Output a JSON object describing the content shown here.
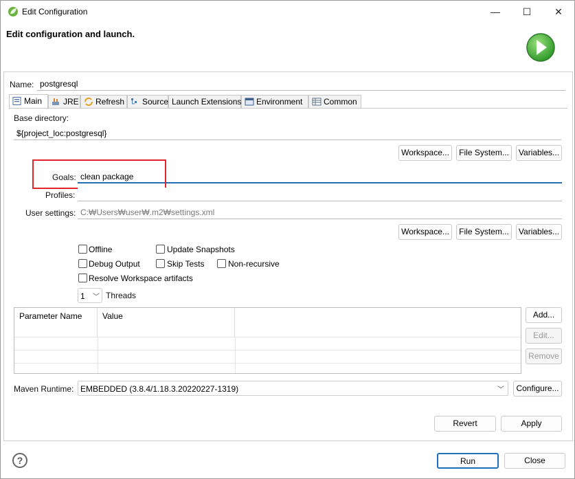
{
  "window": {
    "title": "Edit Configuration",
    "minimize": "—",
    "maximize": "☐",
    "close": "✕"
  },
  "header": {
    "title": "Edit configuration and launch."
  },
  "name": {
    "label": "Name:",
    "value": "postgresql"
  },
  "tabs": [
    {
      "label": "Main",
      "icon": "main-tab-icon"
    },
    {
      "label": "JRE",
      "icon": "jre-icon"
    },
    {
      "label": "Refresh",
      "icon": "refresh-icon"
    },
    {
      "label": "Source",
      "icon": "source-icon"
    },
    {
      "label": "Launch Extensions",
      "icon": ""
    },
    {
      "label": "Environment",
      "icon": "environment-icon"
    },
    {
      "label": "Common",
      "icon": "common-icon"
    }
  ],
  "main": {
    "base_dir_label": "Base directory:",
    "base_dir_value": "${project_loc:postgresql}",
    "workspace_btn": "Workspace...",
    "filesystem_btn": "File System...",
    "variables_btn": "Variables...",
    "goals_label": "Goals:",
    "goals_value": "clean package",
    "profiles_label": "Profiles:",
    "profiles_value": "",
    "user_settings_label": "User settings:",
    "user_settings_placeholder": "C:₩Users₩user₩.m2₩settings.xml",
    "checkboxes": {
      "offline": "Offline",
      "update_snapshots": "Update Snapshots",
      "debug_output": "Debug Output",
      "skip_tests": "Skip Tests",
      "non_recursive": "Non-recursive",
      "resolve_workspace": "Resolve Workspace artifacts"
    },
    "threads_value": "1",
    "threads_label": "Threads",
    "table": {
      "col1": "Parameter Name",
      "col2": "Value"
    },
    "add_btn": "Add...",
    "edit_btn": "Edit...",
    "remove_btn": "Remove",
    "runtime_label": "Maven Runtime:",
    "runtime_value": "EMBEDDED (3.8.4/1.18.3.20220227-1319)",
    "configure_btn": "Configure...",
    "revert_btn": "Revert",
    "apply_btn": "Apply"
  },
  "footer": {
    "help": "?",
    "run_btn": "Run",
    "close_btn": "Close"
  },
  "colors": {
    "highlight": "#e3242b",
    "focus_line": "#1f6fb8",
    "run_green": "#3aa535"
  }
}
